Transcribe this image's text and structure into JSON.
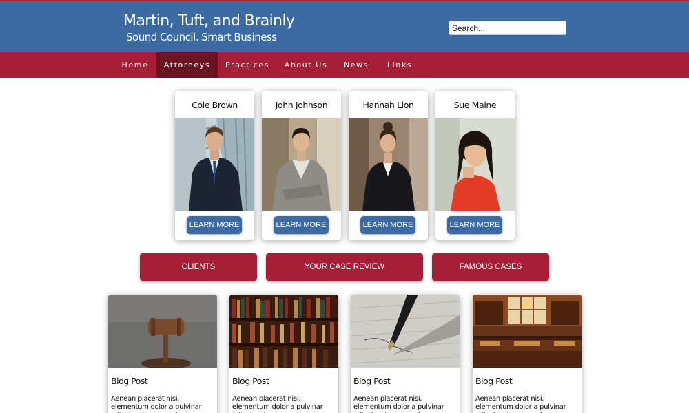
{
  "header": {
    "title": "Martin, Tuft, and Brainly",
    "tagline": "Sound Council. Smart Business",
    "search_placeholder": "Search..."
  },
  "nav": {
    "items": [
      {
        "label": "Home"
      },
      {
        "label": "Attorneys"
      },
      {
        "label": "Practices"
      },
      {
        "label": "About Us"
      },
      {
        "label": "News"
      },
      {
        "label": "Links"
      }
    ],
    "active": "Attorneys"
  },
  "attorneys": [
    {
      "name": "Cole Brown",
      "button": "LEARN MORE"
    },
    {
      "name": "John Johnson",
      "button": "LEARN MORE"
    },
    {
      "name": "Hannah Lion",
      "button": "LEARN MORE"
    },
    {
      "name": "Sue Maine",
      "button": "LEARN MORE"
    }
  ],
  "actions": [
    {
      "label": "CLIENTS"
    },
    {
      "label": "YOUR CASE REVIEW"
    },
    {
      "label": "FAMOUS CASES"
    }
  ],
  "blog": [
    {
      "title": "Blog Post",
      "text": "Aenean placerat nisi, elementum dolor a pulvinar odio, turpis urna, est",
      "image": "gavel-photo"
    },
    {
      "title": "Blog Post",
      "text": "Aenean placerat nisi, elementum dolor a pulvinar odio, turpis urna, est",
      "image": "bookshelf-photo"
    },
    {
      "title": "Blog Post",
      "text": "Aenean placerat nisi, elementum dolor a pulvinar odio, turpis urna, est",
      "image": "fountain-pen-photo"
    },
    {
      "title": "Blog Post",
      "text": "Aenean placerat nisi, elementum dolor a pulvinar odio, turpis urna, est",
      "image": "library-photo"
    }
  ],
  "colors": {
    "header_blue": "#3c6aa3",
    "nav_red": "#a71f37",
    "nav_active": "#6a1420",
    "button_blue": "#3c6aa3"
  }
}
